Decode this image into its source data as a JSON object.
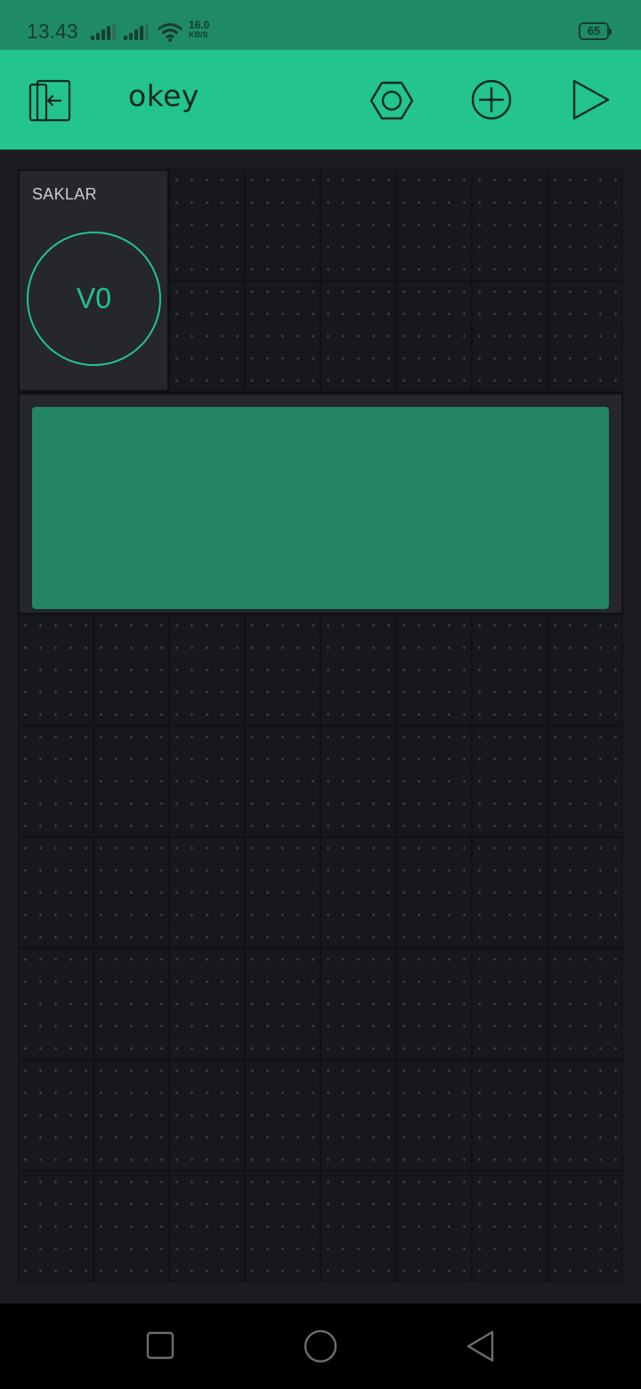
{
  "status_bar": {
    "time": "13.43",
    "net_speed_value": "16.0",
    "net_speed_unit": "KB/S",
    "battery": "65",
    "icons": [
      "signal-bars-icon",
      "signal-bars-icon",
      "wifi-icon",
      "battery-icon"
    ]
  },
  "app_bar": {
    "title": "okey",
    "icons": [
      "exit-icon",
      "settings-hexagon-icon",
      "add-widget-icon",
      "play-icon"
    ]
  },
  "widgets": {
    "button": {
      "label": "SAKLAR",
      "pin": "V0"
    },
    "lcd": {}
  },
  "nav_bar": {
    "icons": [
      "recent-apps-icon",
      "home-icon",
      "back-icon"
    ]
  },
  "colors": {
    "status_bar": "#1f8a68",
    "accent": "#23c48e",
    "lcd_screen": "#238563",
    "canvas": "#1b1c21",
    "widget_bg": "#25272c"
  }
}
